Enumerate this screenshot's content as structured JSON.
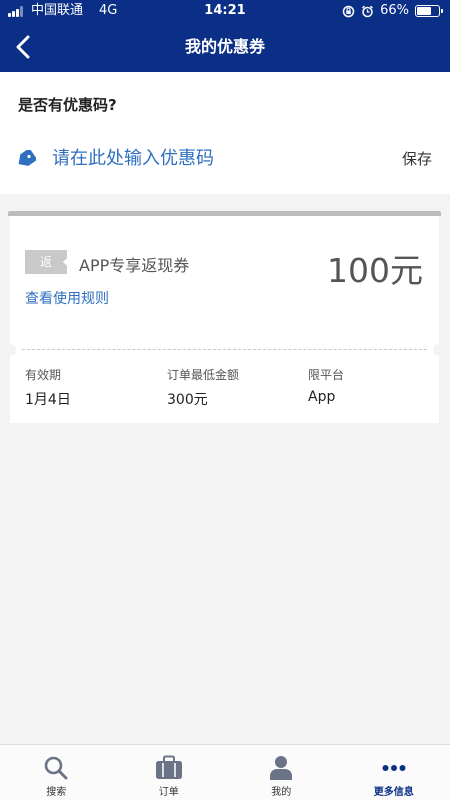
{
  "status_bar": {
    "carrier": "中国联通",
    "network": "4G",
    "time": "14:21",
    "battery": "66%",
    "battery_level": 0.66
  },
  "header": {
    "title": "我的优惠券"
  },
  "promo": {
    "question": "是否有优惠码?",
    "placeholder": "请在此处输入优惠码",
    "save_label": "保存"
  },
  "coupon": {
    "badge": "返",
    "title": "APP专享返现券",
    "amount": "100元",
    "rules_link": "查看使用规则",
    "details": [
      {
        "label": "有效期",
        "value": "1月4日"
      },
      {
        "label": "订单最低金额",
        "value": "300元"
      },
      {
        "label": "限平台",
        "value": "App"
      }
    ]
  },
  "tabs": [
    {
      "label": "搜索",
      "icon": "search-icon"
    },
    {
      "label": "订单",
      "icon": "briefcase-icon"
    },
    {
      "label": "我的",
      "icon": "person-icon"
    },
    {
      "label": "更多信息",
      "icon": "more-dots-icon",
      "active": true
    }
  ],
  "colors": {
    "header_bg": "#0b2f86",
    "link": "#2f6fc0",
    "page_bg": "#f3f3f4"
  }
}
